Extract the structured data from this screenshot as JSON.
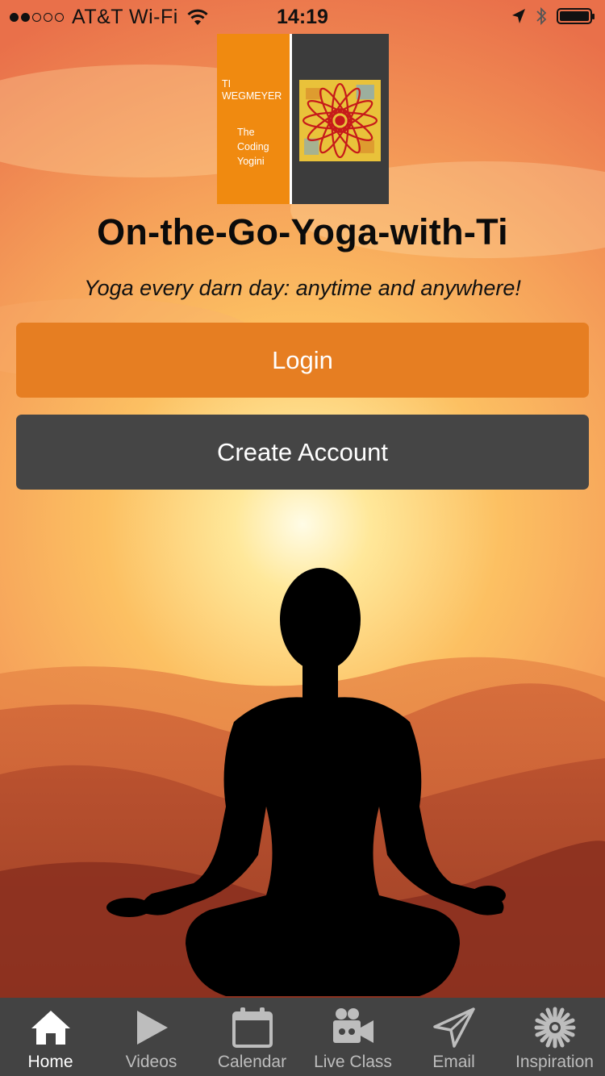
{
  "status_bar": {
    "carrier": "AT&T Wi-Fi",
    "time": "14:19",
    "signal_strength_bars": 2,
    "signal_total_bars": 5
  },
  "logo": {
    "author": "TI WEGMEYER",
    "subtitle_line1": "The",
    "subtitle_line2": "Coding",
    "subtitle_line3": "Yogini"
  },
  "header": {
    "title": "On-the-Go-Yoga-with-Ti",
    "tagline": "Yoga every darn day: anytime and anywhere!"
  },
  "actions": {
    "login_label": "Login",
    "create_account_label": "Create Account"
  },
  "tabbar": {
    "items": [
      {
        "label": "Home",
        "icon": "home-icon",
        "active": true
      },
      {
        "label": "Videos",
        "icon": "play-icon",
        "active": false
      },
      {
        "label": "Calendar",
        "icon": "calendar-icon",
        "active": false
      },
      {
        "label": "Live Class",
        "icon": "video-camera-icon",
        "active": false
      },
      {
        "label": "Email",
        "icon": "paper-plane-icon",
        "active": false
      },
      {
        "label": "Inspiration",
        "icon": "flower-icon",
        "active": false
      }
    ]
  },
  "colors": {
    "login_button": "#e67e22",
    "create_button": "#454545",
    "tabbar_bg": "#434343",
    "logo_orange": "#f08a10",
    "logo_gray": "#3c3c3c"
  }
}
